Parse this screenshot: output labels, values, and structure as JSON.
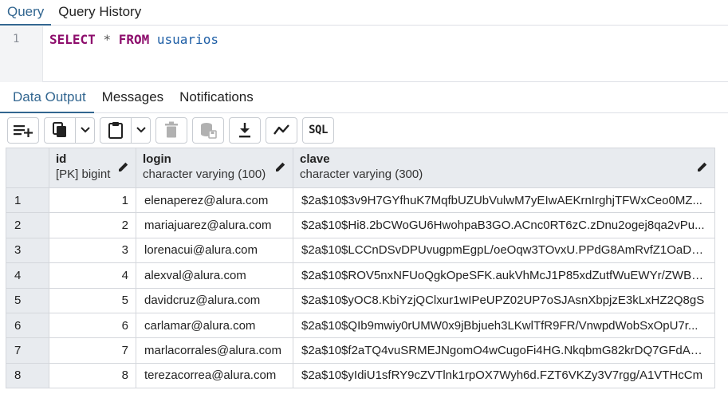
{
  "query_tabs": [
    {
      "label": "Query",
      "active": true
    },
    {
      "label": "Query History",
      "active": false
    }
  ],
  "editor": {
    "line_number": "1",
    "tokens": {
      "select": "SELECT",
      "star": "*",
      "from": "FROM",
      "table": "usuarios"
    }
  },
  "output_tabs": [
    {
      "label": "Data Output",
      "active": true
    },
    {
      "label": "Messages",
      "active": false
    },
    {
      "label": "Notifications",
      "active": false
    }
  ],
  "toolbar": {
    "icons": [
      "add-row-icon",
      "copy-icon",
      "chevron-down-icon",
      "paste-icon",
      "chevron-down-icon",
      "delete-icon",
      "save-data-icon",
      "download-icon",
      "graph-icon",
      "sql-icon"
    ],
    "sql_label": "SQL"
  },
  "grid": {
    "columns": [
      {
        "name": "id",
        "type": "[PK] bigint"
      },
      {
        "name": "login",
        "type": "character varying (100)"
      },
      {
        "name": "clave",
        "type": "character varying (300)"
      }
    ],
    "rows": [
      {
        "num": "1",
        "id": "1",
        "login": "elenaperez@alura.com",
        "clave": "$2a$10$3v9H7GYfhuK7MqfbUZUbVulwM7yEIwAEKrnIrghjTFWxCeo0MZ..."
      },
      {
        "num": "2",
        "id": "2",
        "login": "mariajuarez@alura.com",
        "clave": "$2a$10$Hi8.2bCWoGU6HwohpaB3GO.ACnc0RT6zC.zDnu2ogej8qa2vPu..."
      },
      {
        "num": "3",
        "id": "3",
        "login": "lorenacui@alura.com",
        "clave": "$2a$10$LCCnDSvDPUvugpmEgpL/oeOqw3TOvxU.PPdG8AmRvfZ1OaDo..."
      },
      {
        "num": "4",
        "id": "4",
        "login": "alexval@alura.com",
        "clave": "$2a$10$ROV5nxNFUoQgkOpeSFK.aukVhMcJ1P85xdZutfWuEWYr/ZWBh..."
      },
      {
        "num": "5",
        "id": "5",
        "login": "davidcruz@alura.com",
        "clave": "$2a$10$yOC8.KbiYzjQClxur1wIPeUPZ02UP7oSJAsnXbpjzE3kLxHZ2Q8gS"
      },
      {
        "num": "6",
        "id": "6",
        "login": "carlamar@alura.com",
        "clave": "$2a$10$QIb9mwiy0rUMW0x9jBbjueh3LKwlTfR9FR/VnwpdWobSxOpU7r..."
      },
      {
        "num": "7",
        "id": "7",
        "login": "marlacorrales@alura.com",
        "clave": "$2a$10$f2aTQ4vuSRMEJNgomO4wCugoFi4HG.NkqbmG82krDQ7GFdAZ..."
      },
      {
        "num": "8",
        "id": "8",
        "login": "terezacorrea@alura.com",
        "clave": "$2a$10$yIdiU1sfRY9cZVTlnk1rpOX7Wyh6d.FZT6VKZy3V7rgg/A1VTHcCm"
      }
    ]
  }
}
